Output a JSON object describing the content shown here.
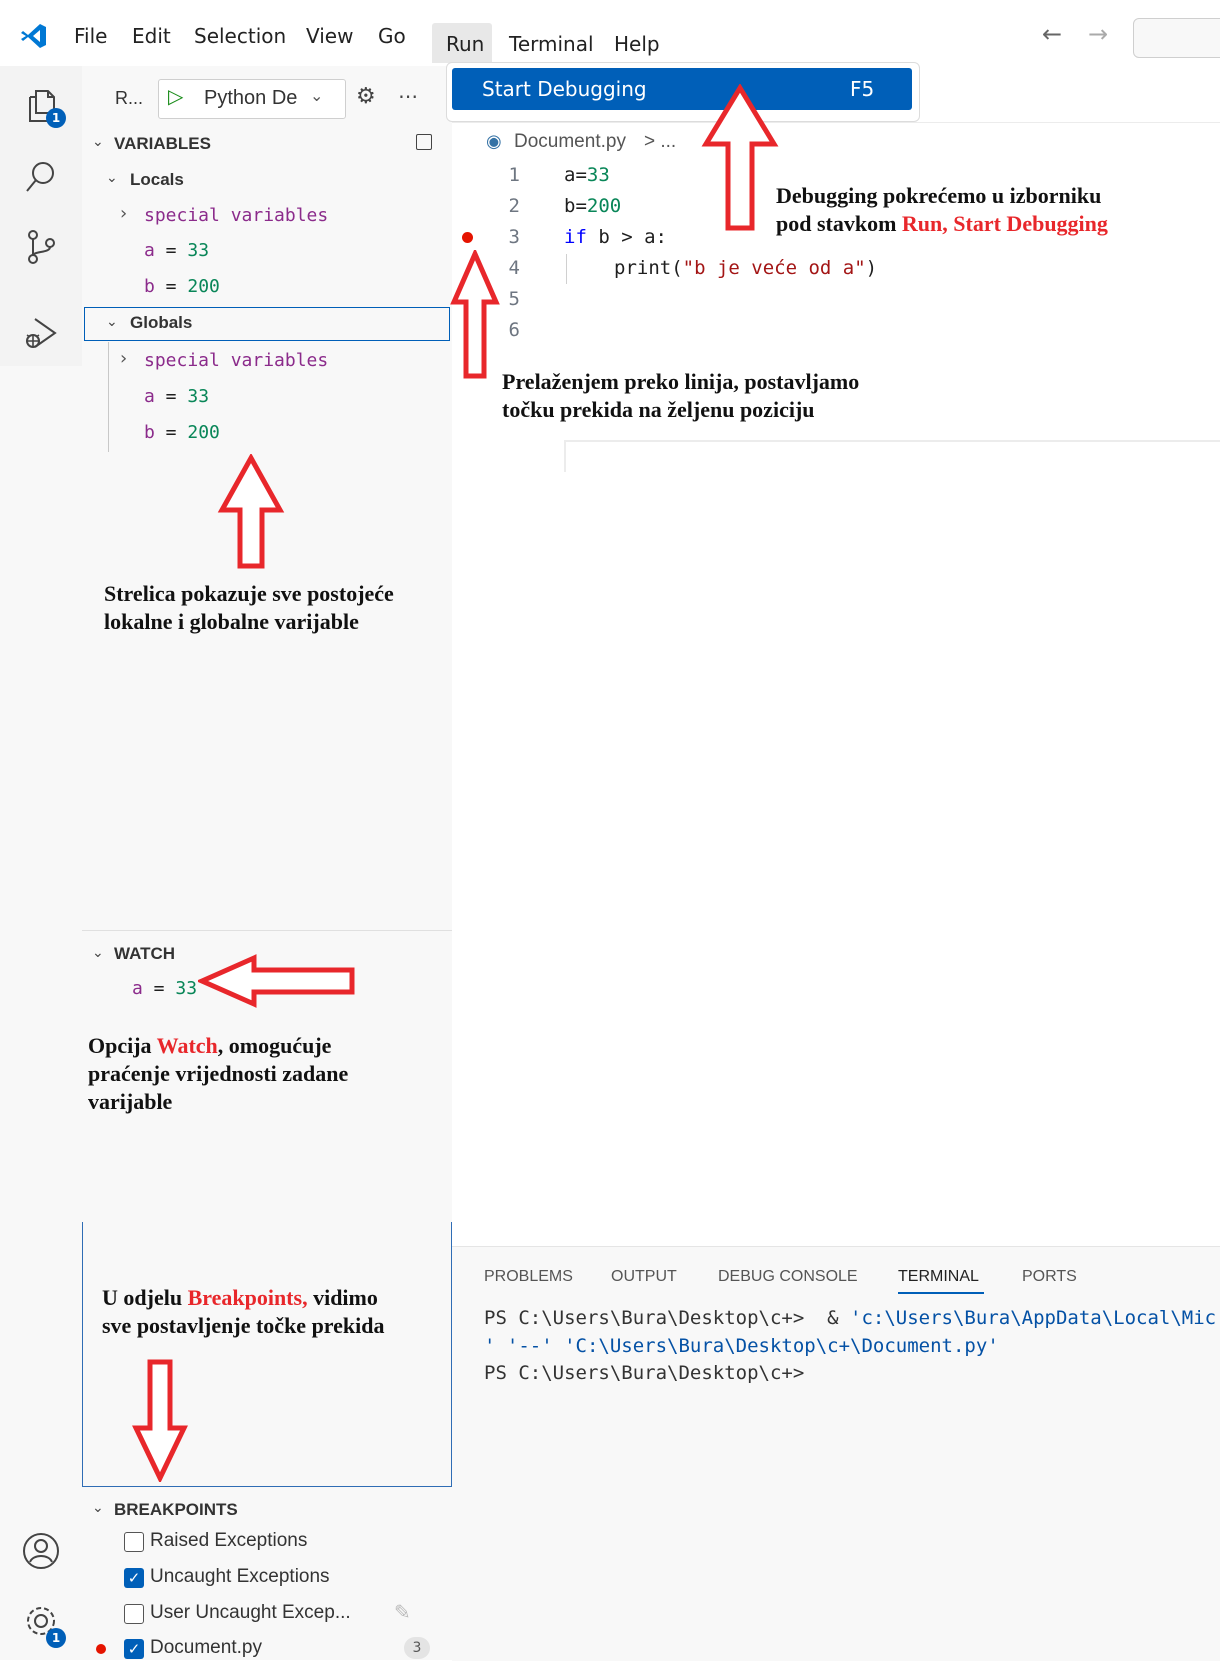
{
  "menubar": {
    "items": [
      "File",
      "Edit",
      "Selection",
      "View",
      "Go",
      "Run",
      "Terminal",
      "Help"
    ],
    "back_icon": "arrow-left-icon",
    "forward_icon": "arrow-right-icon"
  },
  "activity_bar": {
    "explorer_badge": "1",
    "settings_badge": "1"
  },
  "debug_toolbar": {
    "view_label": "R...",
    "config_name": "Python De",
    "more": "⋯"
  },
  "variables": {
    "title": "VARIABLES",
    "locals_label": "Locals",
    "globals_label": "Globals",
    "special_label": "special variables",
    "locals": [
      {
        "name": "a",
        "eq": " = ",
        "value": "33"
      },
      {
        "name": "b",
        "eq": " = ",
        "value": "200"
      }
    ],
    "globals": [
      {
        "name": "a",
        "eq": " = ",
        "value": "33"
      },
      {
        "name": "b",
        "eq": " = ",
        "value": "200"
      }
    ]
  },
  "watch": {
    "title": "WATCH",
    "items": [
      {
        "name": "a",
        "eq": " = ",
        "value": "33"
      }
    ]
  },
  "breakpoints": {
    "title": "BREAKPOINTS",
    "items": [
      {
        "label": "Raised Exceptions",
        "checked": false
      },
      {
        "label": "Uncaught Exceptions",
        "checked": true
      },
      {
        "label": "User Uncaught Excep...",
        "checked": false
      },
      {
        "label": "Document.py",
        "checked": true,
        "count": "3"
      }
    ]
  },
  "run_menu": {
    "start_label": "Start Debugging",
    "start_shortcut": "F5"
  },
  "editor": {
    "breadcrumb_file": "Document.py",
    "breadcrumb_more": "> ...",
    "line_numbers": [
      "1",
      "2",
      "3",
      "4",
      "5",
      "6"
    ],
    "line1": {
      "a": "a=",
      "b": "33"
    },
    "line2": {
      "a": "b=",
      "b": "200"
    },
    "line3": {
      "kw": "if",
      "rest": " b > a:"
    },
    "line4": {
      "fn": "print(",
      "str": "\"b je veće od a\"",
      "end": ")"
    }
  },
  "panel": {
    "tabs": [
      "PROBLEMS",
      "OUTPUT",
      "DEBUG CONSOLE",
      "TERMINAL",
      "PORTS"
    ],
    "active_tab": "TERMINAL",
    "terminal_lines": [
      {
        "prompt": "PS C:\\Users\\Bura\\Desktop\\c+>  & ",
        "str": "'c:\\Users\\Bura\\AppData\\Local\\Mic"
      },
      {
        "prompt": "",
        "str": "' '--' 'C:\\Users\\Bura\\Desktop\\c+\\Document.py'"
      },
      {
        "prompt": "PS C:\\Users\\Bura\\Desktop\\c+>",
        "str": ""
      }
    ]
  },
  "annotations": {
    "run_note_1": "Debugging pokrećemo u izborniku",
    "run_note_2_plain": "pod stavkom ",
    "run_note_2_red": "Run, Start Debugging",
    "bp_note_1": "Prelaženjem preko linija, postavljamo",
    "bp_note_2": "točku prekida na željenu poziciju",
    "vars_note_1": "Strelica pokazuje sve postojeće",
    "vars_note_2": "lokalne i globalne varijable",
    "watch_note_1_plain": "Opcija ",
    "watch_note_1_red": "Watch",
    "watch_note_1_rest": ", omogućuje",
    "watch_note_2": "praćenje vrijednosti zadane",
    "watch_note_3": "varijable",
    "breakpoints_note_1_plain": "U odjelu ",
    "breakpoints_note_1_red": "Breakpoints,",
    "breakpoints_note_1_rest": " vidimo",
    "breakpoints_note_2": "sve postavljenje točke prekida"
  },
  "colors": {
    "accent": "#005fb8",
    "annotation_red": "#e8272b",
    "breakpoint_dot": "#e51400"
  }
}
